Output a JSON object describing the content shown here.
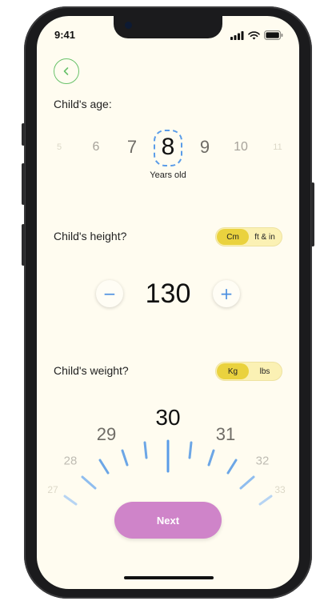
{
  "status_bar": {
    "time": "9:41",
    "icons": [
      "signal-icon",
      "wifi-icon",
      "battery-icon"
    ]
  },
  "back_button": {
    "icon": "chevron-left-icon"
  },
  "age": {
    "label": "Child's age:",
    "options": [
      "5",
      "6",
      "7",
      "8",
      "9",
      "10",
      "11"
    ],
    "selected": "8",
    "unit_caption": "Years old"
  },
  "height": {
    "label": "Child's  height?",
    "units": [
      "Cm",
      "ft & in"
    ],
    "selected_unit": "Cm",
    "value": "130",
    "decrement_symbol": "−",
    "increment_symbol": "+"
  },
  "weight": {
    "label": "Child's  weight?",
    "units": [
      "Kg",
      "lbs"
    ],
    "selected_unit": "Kg",
    "dial_values": [
      "27",
      "28",
      "29",
      "30",
      "31",
      "32",
      "33"
    ],
    "selected": "30"
  },
  "next_button": {
    "label": "Next"
  },
  "colors": {
    "screen_bg": "#fffcf0",
    "accent_green": "#69c26a",
    "accent_blue": "#5a9ce8",
    "toggle_bg": "#fbf1b4",
    "toggle_active": "#ead23e",
    "next_button": "#cf84c9"
  }
}
